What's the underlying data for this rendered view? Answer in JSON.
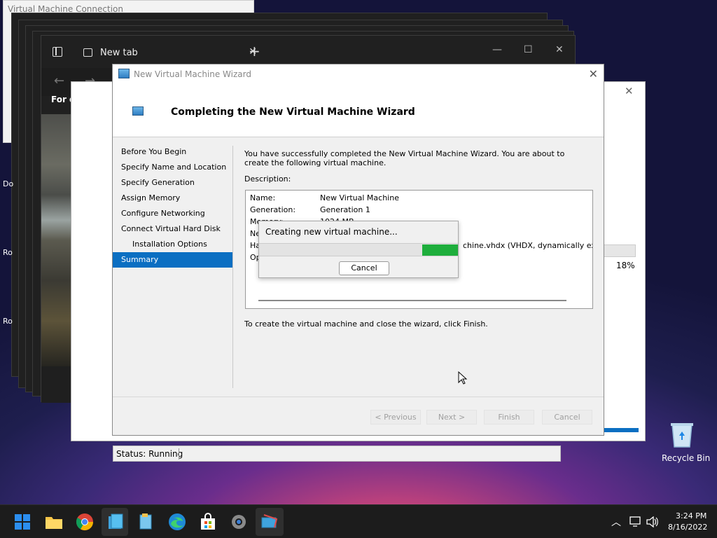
{
  "background_windows": {
    "top_title": "Virtual Machine Connection",
    "top_letter": "F"
  },
  "browser": {
    "tab_title": "New tab",
    "quick_access": "For quick access"
  },
  "desktop_labels": [
    "Do",
    "Ro",
    "Ro"
  ],
  "wizard": {
    "title": "New Virtual Machine Wizard",
    "heading": "Completing the New Virtual Machine Wizard",
    "steps": [
      "Before You Begin",
      "Specify Name and Location",
      "Specify Generation",
      "Assign Memory",
      "Configure Networking",
      "Connect Virtual Hard Disk",
      "Installation Options",
      "Summary"
    ],
    "active_step": "Summary",
    "intro": "You have successfully completed the New Virtual Machine Wizard. You are about to create the following virtual machine.",
    "description_label": "Description:",
    "description": [
      {
        "key": "Name:",
        "value": "New Virtual Machine"
      },
      {
        "key": "Generation:",
        "value": "Generation 1"
      },
      {
        "key": "Memory:",
        "value": "1024 MB"
      },
      {
        "key": "Ne",
        "value": ""
      },
      {
        "key": "Ha",
        "value": "chine.vhdx (VHDX, dynamically expandi"
      },
      {
        "key": "Op",
        "value": ""
      }
    ],
    "finish_text": "To create the virtual machine and close the wizard, click Finish.",
    "buttons": {
      "previous": "< Previous",
      "next": "Next >",
      "finish": "Finish",
      "cancel": "Cancel"
    }
  },
  "progress_dialog": {
    "title": "Creating new virtual machine...",
    "cancel": "Cancel",
    "fill": {
      "start": 0.82,
      "end": 1.0
    }
  },
  "vm_connection": {
    "percent": "18%",
    "status": "Status: Running"
  },
  "recycle_bin": {
    "label": "Recycle Bin"
  },
  "taskbar": {
    "time": "3:24 PM",
    "date": "8/16/2022"
  },
  "colors": {
    "accent": "#0b6fc2",
    "progress": "#1eae3c"
  }
}
